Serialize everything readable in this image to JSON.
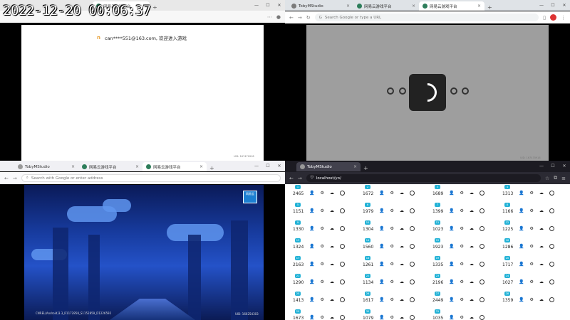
{
  "overlay": {
    "timestamp": "2022-12-20 00:06:37"
  },
  "q1": {
    "tabs": [
      {
        "label": "网易云游戏平台"
      }
    ],
    "welcome_logo": "n",
    "welcome_text": "can****551@163.com, 欢迎进入游戏",
    "watermark": "UID: 167470918"
  },
  "q2": {
    "tabs": [
      {
        "label": "TobyMStudio"
      },
      {
        "label": "网易云游戏平台"
      },
      {
        "label": "网易云游戏平台"
      }
    ],
    "address_placeholder": "Search Google or type a URL",
    "watermark": "UID: 167470918"
  },
  "q3": {
    "tabs": [
      {
        "label": "TobyMStudio"
      },
      {
        "label": "网易云游戏平台"
      },
      {
        "label": "网易云游戏平台"
      }
    ],
    "address_placeholder": "Search with Google or enter address",
    "badge": "网易云",
    "version_text": "CNREL(Android)3.3_R1172858_S1152859_D1226592",
    "uid_text": "UID: 166254303"
  },
  "q4": {
    "tab_label": "TobyMStudio",
    "url": "localhost/yo/",
    "accounts": [
      {
        "id": "1",
        "value": "2465"
      },
      {
        "id": "2",
        "value": "1672"
      },
      {
        "id": "3",
        "value": "1689"
      },
      {
        "id": "4",
        "value": "1313"
      },
      {
        "id": "5",
        "value": "1151"
      },
      {
        "id": "6",
        "value": "1979"
      },
      {
        "id": "7",
        "value": "1399"
      },
      {
        "id": "8",
        "value": "1166"
      },
      {
        "id": "9",
        "value": "1330"
      },
      {
        "id": "10",
        "value": "1304"
      },
      {
        "id": "11",
        "value": "1023"
      },
      {
        "id": "12",
        "value": "1225"
      },
      {
        "id": "13",
        "value": "1324"
      },
      {
        "id": "14",
        "value": "1560"
      },
      {
        "id": "15",
        "value": "1923"
      },
      {
        "id": "16",
        "value": "1286"
      },
      {
        "id": "17",
        "value": "2163"
      },
      {
        "id": "18",
        "value": "1261"
      },
      {
        "id": "19",
        "value": "1335"
      },
      {
        "id": "20",
        "value": "1717"
      },
      {
        "id": "21",
        "value": "1290"
      },
      {
        "id": "22",
        "value": "1134"
      },
      {
        "id": "23",
        "value": "2196"
      },
      {
        "id": "24",
        "value": "1027"
      },
      {
        "id": "25",
        "value": "1413"
      },
      {
        "id": "26",
        "value": "1617"
      },
      {
        "id": "27",
        "value": "2449"
      },
      {
        "id": "28",
        "value": "1359"
      },
      {
        "id": "29",
        "value": "1673"
      },
      {
        "id": "30",
        "value": "1079"
      },
      {
        "id": "31",
        "value": "1035"
      }
    ]
  },
  "colors": {
    "accent": "#23b2d6",
    "firefox_dark": "#1c1b22"
  }
}
